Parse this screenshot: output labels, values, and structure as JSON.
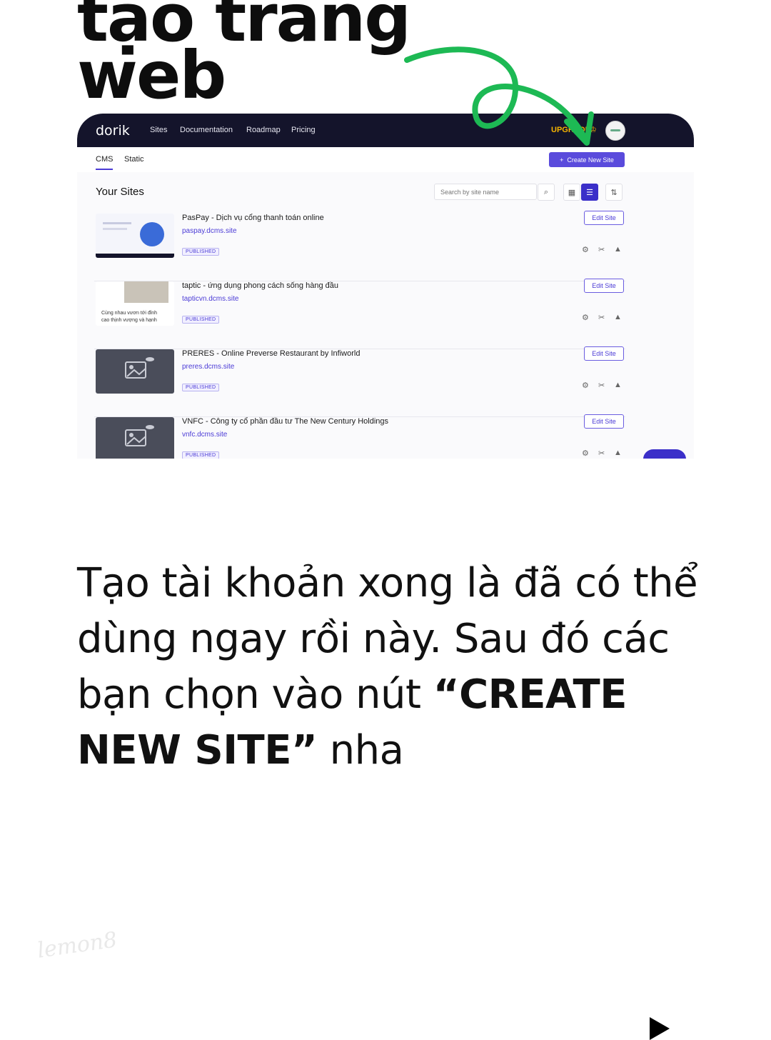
{
  "headline": {
    "line1": "tạo trang",
    "line2": "web"
  },
  "dashboard": {
    "logo": "dorik",
    "nav": [
      "Sites",
      "Documentation",
      "Roadmap",
      "Pricing"
    ],
    "upgrade": "UPGRADE",
    "tabs": [
      "CMS",
      "Static"
    ],
    "create_button": "Create New Site",
    "section_title": "Your Sites",
    "search_placeholder": "Search by site name",
    "sites": [
      {
        "title": "PasPay - Dịch vụ cổng thanh toán online",
        "url": "paspay.dcms.site",
        "status": "PUBLISHED",
        "edit": "Edit Site"
      },
      {
        "title": "taptic - ứng dụng phong cách sống hàng đầu",
        "url": "tapticvn.dcms.site",
        "status": "PUBLISHED",
        "edit": "Edit Site",
        "thumb_caption_1": "Cùng nhau vươn tới đỉnh",
        "thumb_caption_2": "cao thịnh vượng và hạnh"
      },
      {
        "title": "PRERES - Online Preverse Restaurant by Infiworld",
        "url": "preres.dcms.site",
        "status": "PUBLISHED",
        "edit": "Edit Site"
      },
      {
        "title": "VNFC - Công ty cổ phần đầu tư The New Century Holdings",
        "url": "vnfc.dcms.site",
        "status": "PUBLISHED",
        "edit": "Edit Site"
      }
    ]
  },
  "caption": {
    "part1": "Tạo tài khoản xong là đã có thể dùng ngay rồi này. Sau đó các bạn chọn vào nút ",
    "bold": "“CREATE NEW SITE”",
    "part2": " nha"
  },
  "watermark": "lemon8",
  "colors": {
    "accent": "#4b3bd6",
    "nav_bg": "#14142b",
    "arrow": "#1db954",
    "upgrade": "#f5b400"
  }
}
